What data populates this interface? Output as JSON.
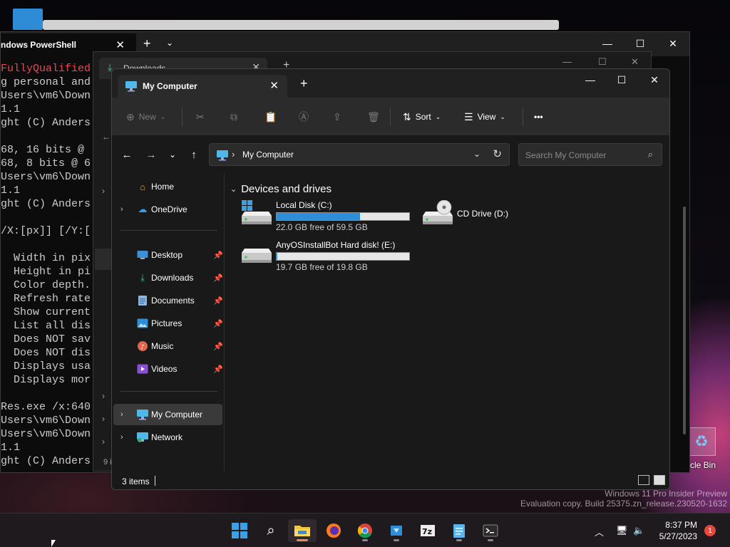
{
  "desktop": {
    "recycle_bin_label": "cle Bin",
    "watermark_line1": "Windows 11 Pro Insider Preview",
    "watermark_line2": "Evaluation copy. Build 25375.zn_release.230520-1632"
  },
  "powershell": {
    "tab_title": "ndows PowerShell",
    "lines": [
      {
        "text": "FullyQualified",
        "color": "red"
      },
      {
        "text": "g personal and",
        "color": "normal"
      },
      {
        "text": "Users\\vm6\\Down",
        "color": "normal"
      },
      {
        "text": "1.1",
        "color": "normal"
      },
      {
        "text": "ght (C) Anders",
        "color": "normal"
      },
      {
        "text": "",
        "color": "normal"
      },
      {
        "text": "68, 16 bits @",
        "color": "normal"
      },
      {
        "text": "68, 8 bits @ 6",
        "color": "normal"
      },
      {
        "text": "Users\\vm6\\Down",
        "color": "normal"
      },
      {
        "text": "1.1",
        "color": "normal"
      },
      {
        "text": "ght (C) Anders",
        "color": "normal"
      },
      {
        "text": "",
        "color": "normal"
      },
      {
        "text": "/X:[px]] [/Y:[",
        "color": "normal"
      },
      {
        "text": "",
        "color": "normal"
      },
      {
        "text": "  Width in pix",
        "color": "normal"
      },
      {
        "text": "  Height in pi",
        "color": "normal"
      },
      {
        "text": "  Color depth.",
        "color": "normal"
      },
      {
        "text": "  Refresh rate",
        "color": "normal"
      },
      {
        "text": "  Show current",
        "color": "normal"
      },
      {
        "text": "  List all dis",
        "color": "normal"
      },
      {
        "text": "  Does NOT sav",
        "color": "normal"
      },
      {
        "text": "  Does NOT dis",
        "color": "normal"
      },
      {
        "text": "  Displays usa",
        "color": "normal"
      },
      {
        "text": "  Displays mor",
        "color": "normal"
      },
      {
        "text": "",
        "color": "normal"
      },
      {
        "text": "Res.exe /x:640",
        "color": "normal"
      },
      {
        "text": "Users\\vm6\\Down",
        "color": "normal"
      },
      {
        "text": "Users\\vm6\\Down",
        "color": "normal"
      },
      {
        "text": "1.1",
        "color": "normal"
      },
      {
        "text": "ght (C) Anders",
        "color": "normal"
      }
    ]
  },
  "downloads": {
    "tab_title": "Downloads",
    "status": "9 i"
  },
  "explorer": {
    "tab_title": "My Computer",
    "toolbar": {
      "new_label": "New",
      "sort_label": "Sort",
      "view_label": "View",
      "more_label": "•••"
    },
    "address": {
      "path": "My Computer"
    },
    "search": {
      "placeholder": "Search My Computer"
    },
    "sidebar": {
      "items": [
        {
          "label": "Home",
          "icon": "home-icon"
        },
        {
          "label": "OneDrive",
          "icon": "onedrive-icon"
        },
        {
          "label": "Desktop",
          "icon": "desktop-icon"
        },
        {
          "label": "Downloads",
          "icon": "downloads-icon"
        },
        {
          "label": "Documents",
          "icon": "documents-icon"
        },
        {
          "label": "Pictures",
          "icon": "pictures-icon"
        },
        {
          "label": "Music",
          "icon": "music-icon"
        },
        {
          "label": "Videos",
          "icon": "videos-icon"
        },
        {
          "label": "My Computer",
          "icon": "computer-icon"
        },
        {
          "label": "Network",
          "icon": "network-icon"
        }
      ]
    },
    "content": {
      "group_header": "Devices and drives",
      "drives": [
        {
          "name": "Local Disk (C:)",
          "free": "22.0 GB free of 59.5 GB",
          "used_fraction": 0.63
        },
        {
          "name": "CD Drive (D:)",
          "free": "",
          "used_fraction": null
        },
        {
          "name": "AnyOSInstallBot Hard disk! (E:)",
          "free": "19.7 GB free of 19.8 GB",
          "used_fraction": 0.005
        }
      ]
    },
    "status": {
      "items_count": "3 items"
    }
  },
  "taskbar": {
    "time": "8:37 PM",
    "date": "5/27/2023",
    "notification_count": "1"
  },
  "colors": {
    "accent": "#2f8ed8",
    "terminal_error": "#e74856"
  }
}
